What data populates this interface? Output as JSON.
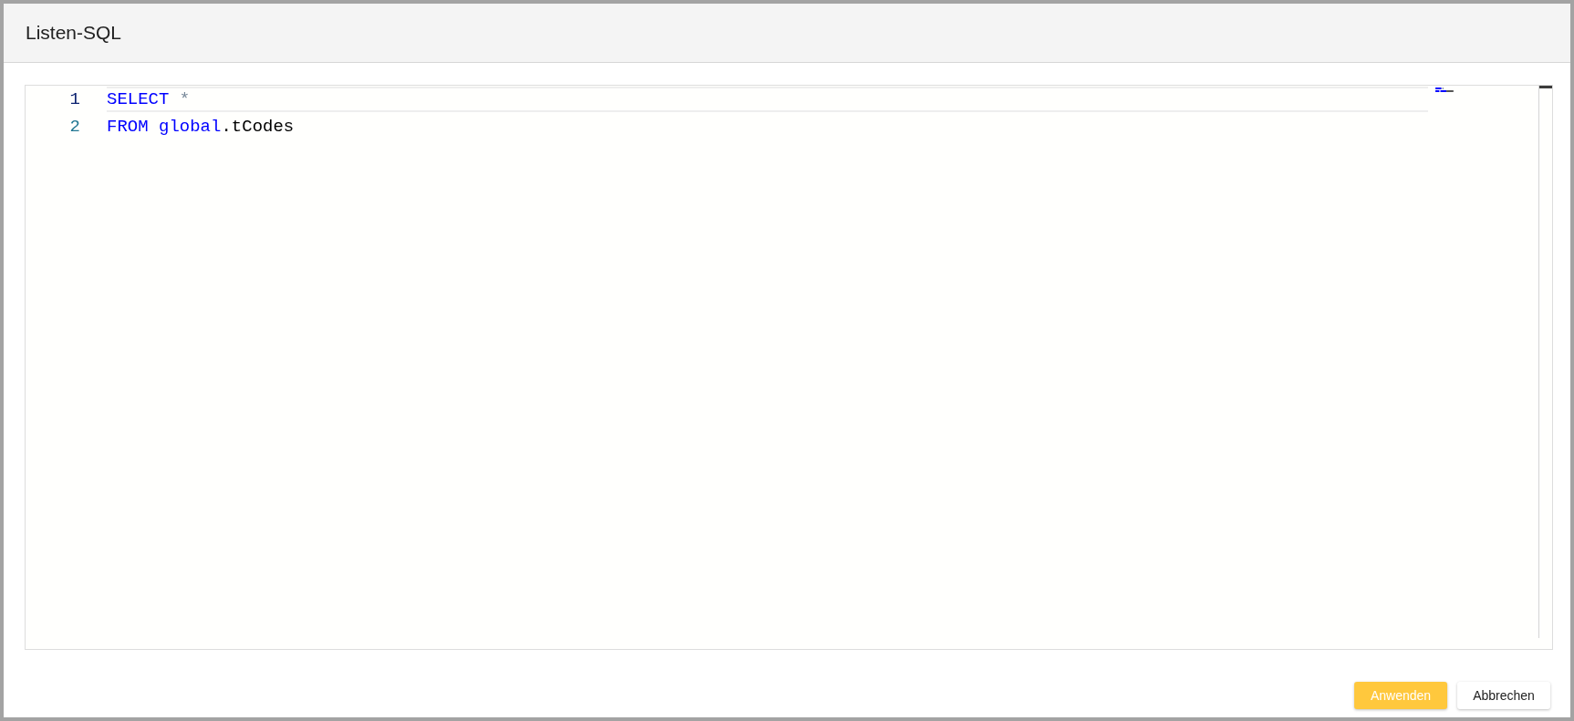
{
  "dialog": {
    "title": "Listen-SQL"
  },
  "editor": {
    "lines": [
      {
        "number": "1",
        "current": true,
        "tokens": [
          {
            "text": "SELECT",
            "kind": "keyword"
          },
          {
            "text": " *",
            "kind": "operator"
          }
        ]
      },
      {
        "number": "2",
        "current": false,
        "tokens": [
          {
            "text": "FROM",
            "kind": "keyword"
          },
          {
            "text": " global",
            "kind": "keyword"
          },
          {
            "text": ".tCodes",
            "kind": "identifier"
          }
        ]
      }
    ]
  },
  "buttons": [
    {
      "label": "Anwenden",
      "kind": "primary"
    },
    {
      "label": "Abbrechen",
      "kind": "secondary"
    }
  ]
}
